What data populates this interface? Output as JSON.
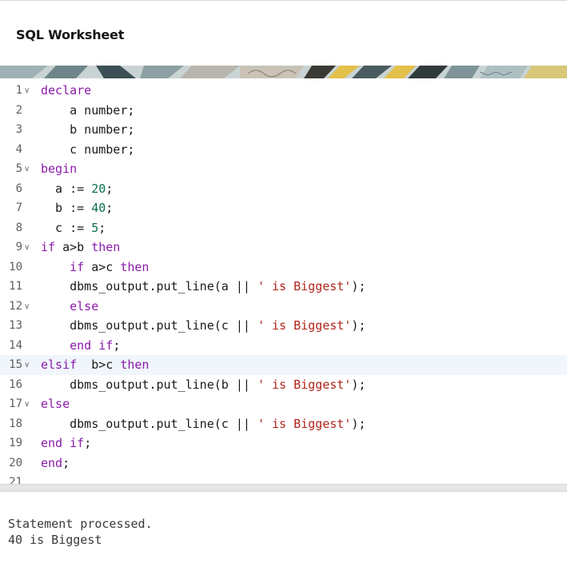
{
  "header": {
    "title": "SQL Worksheet"
  },
  "editor": {
    "active_line": 15,
    "lines": [
      {
        "n": "1",
        "fold": true,
        "tokens": [
          {
            "t": "kw",
            "v": "declare"
          }
        ]
      },
      {
        "n": "2",
        "fold": false,
        "tokens": [
          {
            "t": "plain",
            "v": "    a number;"
          }
        ]
      },
      {
        "n": "3",
        "fold": false,
        "tokens": [
          {
            "t": "plain",
            "v": "    b number;"
          }
        ]
      },
      {
        "n": "4",
        "fold": false,
        "tokens": [
          {
            "t": "plain",
            "v": "    c number;"
          }
        ]
      },
      {
        "n": "5",
        "fold": true,
        "tokens": [
          {
            "t": "kw",
            "v": "begin"
          }
        ]
      },
      {
        "n": "6",
        "fold": false,
        "tokens": [
          {
            "t": "plain",
            "v": "  a := "
          },
          {
            "t": "num",
            "v": "20"
          },
          {
            "t": "plain",
            "v": ";"
          }
        ]
      },
      {
        "n": "7",
        "fold": false,
        "tokens": [
          {
            "t": "plain",
            "v": "  b := "
          },
          {
            "t": "num",
            "v": "40"
          },
          {
            "t": "plain",
            "v": ";"
          }
        ]
      },
      {
        "n": "8",
        "fold": false,
        "tokens": [
          {
            "t": "plain",
            "v": "  c := "
          },
          {
            "t": "num",
            "v": "5"
          },
          {
            "t": "plain",
            "v": ";"
          }
        ]
      },
      {
        "n": "9",
        "fold": true,
        "tokens": [
          {
            "t": "kw",
            "v": "if"
          },
          {
            "t": "plain",
            "v": " a>b "
          },
          {
            "t": "kw",
            "v": "then"
          }
        ]
      },
      {
        "n": "10",
        "fold": false,
        "tokens": [
          {
            "t": "plain",
            "v": "    "
          },
          {
            "t": "kw",
            "v": "if"
          },
          {
            "t": "plain",
            "v": " a>c "
          },
          {
            "t": "kw",
            "v": "then"
          }
        ]
      },
      {
        "n": "11",
        "fold": false,
        "tokens": [
          {
            "t": "plain",
            "v": "    dbms_output.put_line(a || "
          },
          {
            "t": "str",
            "v": "' is Biggest'"
          },
          {
            "t": "plain",
            "v": ");"
          }
        ]
      },
      {
        "n": "12",
        "fold": true,
        "tokens": [
          {
            "t": "plain",
            "v": "    "
          },
          {
            "t": "kw",
            "v": "else"
          }
        ]
      },
      {
        "n": "13",
        "fold": false,
        "tokens": [
          {
            "t": "plain",
            "v": "    dbms_output.put_line(c || "
          },
          {
            "t": "str",
            "v": "' is Biggest'"
          },
          {
            "t": "plain",
            "v": ");"
          }
        ]
      },
      {
        "n": "14",
        "fold": false,
        "tokens": [
          {
            "t": "plain",
            "v": "    "
          },
          {
            "t": "kw",
            "v": "end if"
          },
          {
            "t": "plain",
            "v": ";"
          }
        ]
      },
      {
        "n": "15",
        "fold": true,
        "tokens": [
          {
            "t": "kw",
            "v": "elsif"
          },
          {
            "t": "plain",
            "v": "  b>c "
          },
          {
            "t": "kw",
            "v": "then"
          }
        ]
      },
      {
        "n": "16",
        "fold": false,
        "tokens": [
          {
            "t": "plain",
            "v": "    dbms_output.put_line(b || "
          },
          {
            "t": "str",
            "v": "' is Biggest'"
          },
          {
            "t": "plain",
            "v": ");"
          }
        ]
      },
      {
        "n": "17",
        "fold": true,
        "tokens": [
          {
            "t": "kw",
            "v": "else"
          }
        ]
      },
      {
        "n": "18",
        "fold": false,
        "tokens": [
          {
            "t": "plain",
            "v": "    dbms_output.put_line(c || "
          },
          {
            "t": "str",
            "v": "' is Biggest'"
          },
          {
            "t": "plain",
            "v": ");"
          }
        ]
      },
      {
        "n": "19",
        "fold": false,
        "tokens": [
          {
            "t": "kw",
            "v": "end if"
          },
          {
            "t": "plain",
            "v": ";"
          }
        ]
      },
      {
        "n": "20",
        "fold": false,
        "tokens": [
          {
            "t": "kw",
            "v": "end"
          },
          {
            "t": "plain",
            "v": ";"
          }
        ]
      },
      {
        "n": "21",
        "fold": false,
        "tokens": []
      }
    ]
  },
  "output": {
    "lines": [
      "Statement processed.",
      "40 is Biggest"
    ]
  },
  "colors": {
    "keyword": "#8a1aa8",
    "number": "#0b6e4f",
    "string": "#b0251b",
    "active_line": "#f0f6fc"
  }
}
